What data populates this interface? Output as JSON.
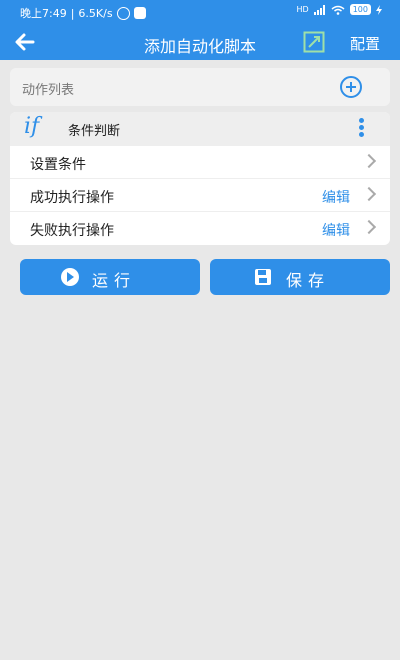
{
  "status_bar": {
    "time": "晚上7:49",
    "speed": "6.5K/s",
    "signal": "HD",
    "battery": "100"
  },
  "app_bar": {
    "title": "添加自动化脚本",
    "config_label": "配置",
    "icons": {
      "back": "arrow-left-icon",
      "resize": "resize-icon"
    }
  },
  "action_list": {
    "header_label": "动作列表",
    "add_icon": "plus-circle-icon"
  },
  "condition_card": {
    "icon_text": "if",
    "title": "条件判断",
    "rows": [
      {
        "label": "设置条件",
        "edit": ""
      },
      {
        "label": "成功执行操作",
        "edit": "编辑"
      },
      {
        "label": "失败执行操作",
        "edit": "编辑"
      }
    ]
  },
  "buttons": {
    "run": "运行",
    "save": "保存"
  },
  "colors": {
    "accent": "#2f8fe8",
    "background": "#e8e8e8"
  }
}
